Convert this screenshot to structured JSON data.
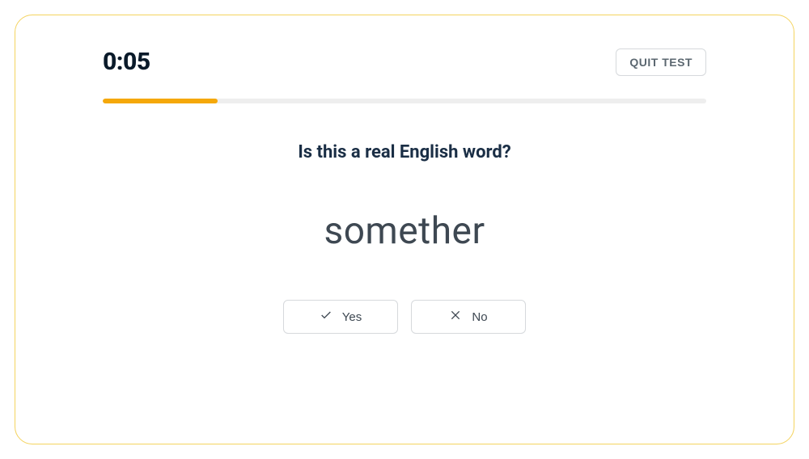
{
  "timer": "0:05",
  "quit_label": "QUIT TEST",
  "progress_percent": 19,
  "question": "Is this a real English word?",
  "word": "somether",
  "yes_label": "Yes",
  "no_label": "No"
}
